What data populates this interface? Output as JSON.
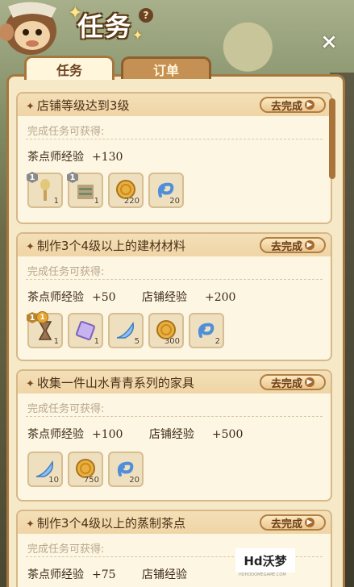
{
  "header": {
    "title": "任务",
    "help": "?"
  },
  "close_label": "×",
  "tabs": [
    {
      "label": "任务",
      "active": true
    },
    {
      "label": "订单",
      "active": false
    }
  ],
  "go_label": "去完成",
  "reward_label": "完成任务可获得:",
  "tasks": [
    {
      "title": "店铺等级达到3级",
      "exp": [
        {
          "label": "茶点师经验",
          "value": "+130"
        }
      ],
      "items": [
        {
          "icon": "tea-bush-sapling",
          "count": "1",
          "badge": "1"
        },
        {
          "icon": "shelf-furniture",
          "count": "1",
          "badge": "1"
        },
        {
          "icon": "gold-coin",
          "count": "220"
        },
        {
          "icon": "blue-spiral-token",
          "count": "20"
        }
      ]
    },
    {
      "title": "制作3个4级以上的建材材料",
      "exp": [
        {
          "label": "茶点师经验",
          "value": "+50"
        },
        {
          "label": "店铺经验",
          "value": "+200"
        }
      ],
      "items": [
        {
          "icon": "hourglass",
          "count": "1",
          "badge": "1",
          "dot": "1"
        },
        {
          "icon": "purple-ticket",
          "count": "1"
        },
        {
          "icon": "blue-feather",
          "count": "5"
        },
        {
          "icon": "gold-coin",
          "count": "300"
        },
        {
          "icon": "blue-spiral-token",
          "count": "2"
        }
      ]
    },
    {
      "title": "收集一件山水青青系列的家具",
      "exp": [
        {
          "label": "茶点师经验",
          "value": "+100"
        },
        {
          "label": "店铺经验",
          "value": "+500"
        }
      ],
      "items": [
        {
          "icon": "blue-feather",
          "count": "10"
        },
        {
          "icon": "gold-coin",
          "count": "750"
        },
        {
          "icon": "blue-spiral-token",
          "count": "20"
        }
      ]
    },
    {
      "title": "制作3个4级以上的蒸制茶点",
      "exp": [
        {
          "label": "茶点师经验",
          "value": "+75"
        },
        {
          "label": "店铺经验",
          "value": ""
        }
      ],
      "items": []
    }
  ],
  "watermark": "Hd沃梦",
  "watermark_sub": "HDHODOMEGAME.COM",
  "colors": {
    "panel": "#f6e9c8",
    "border": "#a6763f",
    "accent": "#6b3d17"
  }
}
